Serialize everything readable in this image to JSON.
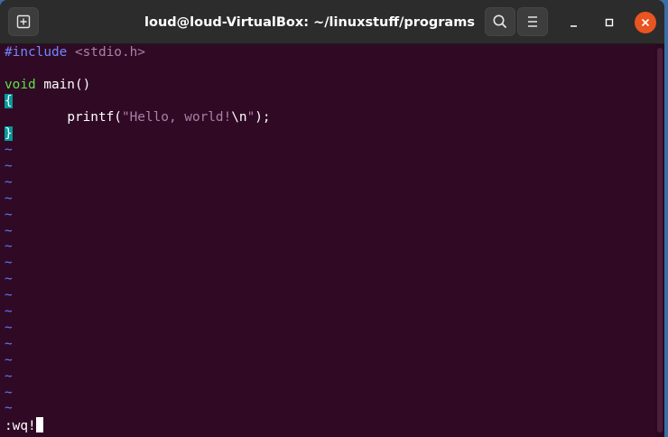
{
  "window": {
    "title": "loud@loud-VirtualBox: ~/linuxstuff/programs"
  },
  "icons": {
    "new_tab": "new-tab-icon",
    "search": "search-icon",
    "menu": "hamburger-menu-icon",
    "minimize": "minimize-icon",
    "maximize": "maximize-icon",
    "close": "close-icon"
  },
  "colors": {
    "terminal_bg": "#300a24",
    "titlebar_bg": "#2c2c2c",
    "close_button": "#e95420",
    "preprocessor": "#6f88ff",
    "keyword": "#5fe04b",
    "string": "#ad7fa8",
    "brace_highlight": "#06989a",
    "tilde": "#5c7cfa"
  },
  "editor": {
    "line1": {
      "directive": "#include",
      "header": "<stdio.h>"
    },
    "line3": {
      "keyword": "void",
      "rest": " main()"
    },
    "line4": {
      "brace": "{"
    },
    "line5": {
      "indent": "        ",
      "func": "printf(",
      "str_open": "\"Hello, world!",
      "escape": "\\n",
      "str_close": "\"",
      "tail": ");"
    },
    "line6": {
      "brace": "}"
    },
    "empty_marker": "~",
    "empty_count": 17,
    "command": ":wq!"
  }
}
